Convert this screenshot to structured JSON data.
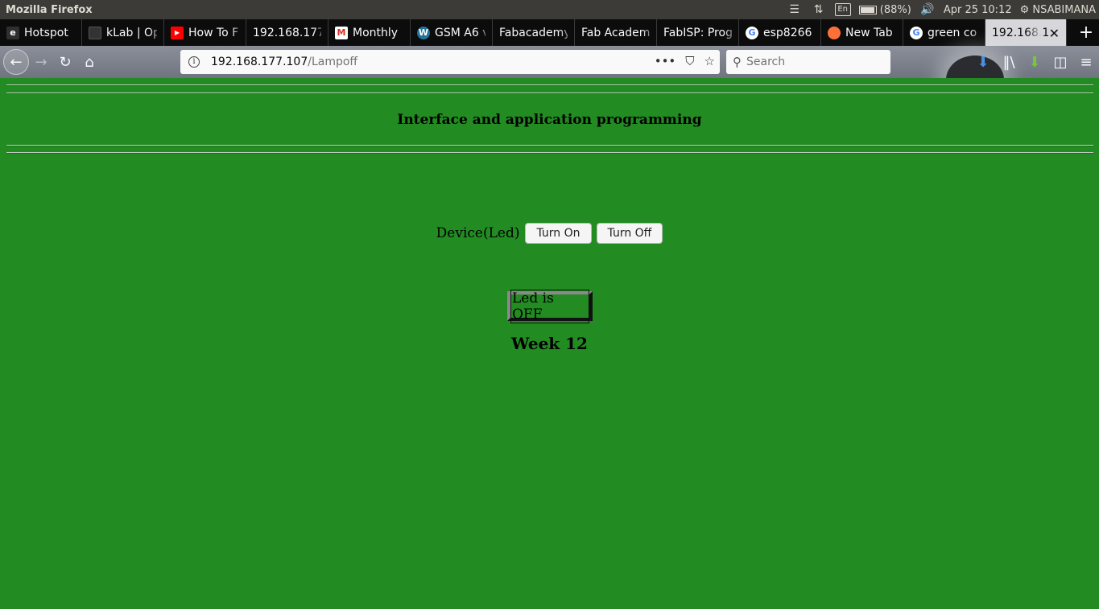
{
  "system": {
    "app_title": "Mozilla Firefox",
    "battery": "(88%)",
    "datetime": "Apr 25 10:12",
    "user": "NSABIMANA",
    "keyboard": "En"
  },
  "tabs": [
    {
      "label": "Hotspot",
      "icon": "e-icon",
      "color": "#2f2f2f"
    },
    {
      "label": "kLab | Op",
      "icon": "klab-icon",
      "color": "#333333"
    },
    {
      "label": "How To F",
      "icon": "youtube-icon",
      "color": "#ff0000"
    },
    {
      "label": "192.168.177",
      "icon": "",
      "color": ""
    },
    {
      "label": "Monthly",
      "icon": "gmail-icon",
      "color": "#d93025"
    },
    {
      "label": "GSM A6 v",
      "icon": "wordpress-icon",
      "color": "#21759b"
    },
    {
      "label": "Fabacademy",
      "icon": "",
      "color": ""
    },
    {
      "label": "Fab Academ",
      "icon": "",
      "color": ""
    },
    {
      "label": "FabISP: Prog",
      "icon": "",
      "color": ""
    },
    {
      "label": "esp8266",
      "icon": "google-icon",
      "color": "#4285f4"
    },
    {
      "label": "New Tab",
      "icon": "firefox-icon",
      "color": "#ff7139"
    },
    {
      "label": "green co",
      "icon": "google-icon",
      "color": "#4285f4"
    },
    {
      "label": "192.168.1",
      "icon": "",
      "color": ""
    }
  ],
  "url": {
    "host": "192.168.177.107",
    "path": "/Lampoff"
  },
  "search": {
    "placeholder": "Search"
  },
  "page": {
    "heading": "Interface and application programming",
    "device_label": "Device(Led)",
    "turn_on": "Turn On",
    "turn_off": "Turn Off",
    "status": "Led is OFF",
    "week": "Week 12",
    "background": "#228B22"
  }
}
